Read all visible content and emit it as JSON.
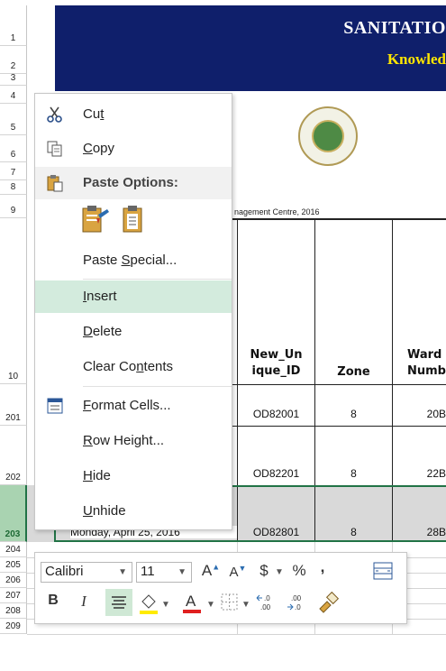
{
  "sheet": {
    "title_line1": "SANITATIO",
    "title_line2": "Knowled",
    "subtitle": "nagement Centre, 2016",
    "row_numbers": [
      "1",
      "2",
      "3",
      "4",
      "5",
      "6",
      "7",
      "8",
      "9",
      "10",
      "201",
      "202",
      "203",
      "204",
      "205",
      "206",
      "207",
      "208",
      "209"
    ],
    "columns": {
      "new_unique_id": "New_Un\nique_ID",
      "zone": "Zone",
      "ward": "Ward\nNumb"
    },
    "rows": [
      {
        "unique_id": "OD82001",
        "zone": "8",
        "ward": "20B"
      },
      {
        "unique_id": "OD82201",
        "zone": "8",
        "ward": "22B"
      },
      {
        "date": "Monday, April 25, 2016",
        "unique_id": "OD82801",
        "zone": "8",
        "ward": "28B"
      }
    ]
  },
  "context_menu": {
    "cut": "Cut",
    "copy": "Copy",
    "paste_options": "Paste Options:",
    "paste_special": "Paste Special...",
    "insert": "Insert",
    "delete": "Delete",
    "clear_contents": "Clear Contents",
    "format_cells": "Format Cells...",
    "row_height": "Row Height...",
    "hide": "Hide",
    "unhide": "Unhide"
  },
  "mini_toolbar": {
    "font_name": "Calibri",
    "font_size": "11",
    "bold": "B",
    "italic": "I",
    "currency": "$",
    "percent": "%",
    "comma": ","
  },
  "colors": {
    "title_bg": "#0f1f6b",
    "subtitle_color": "#ffe600",
    "accent": "#217346",
    "menu_hover": "#d3ebdd"
  }
}
